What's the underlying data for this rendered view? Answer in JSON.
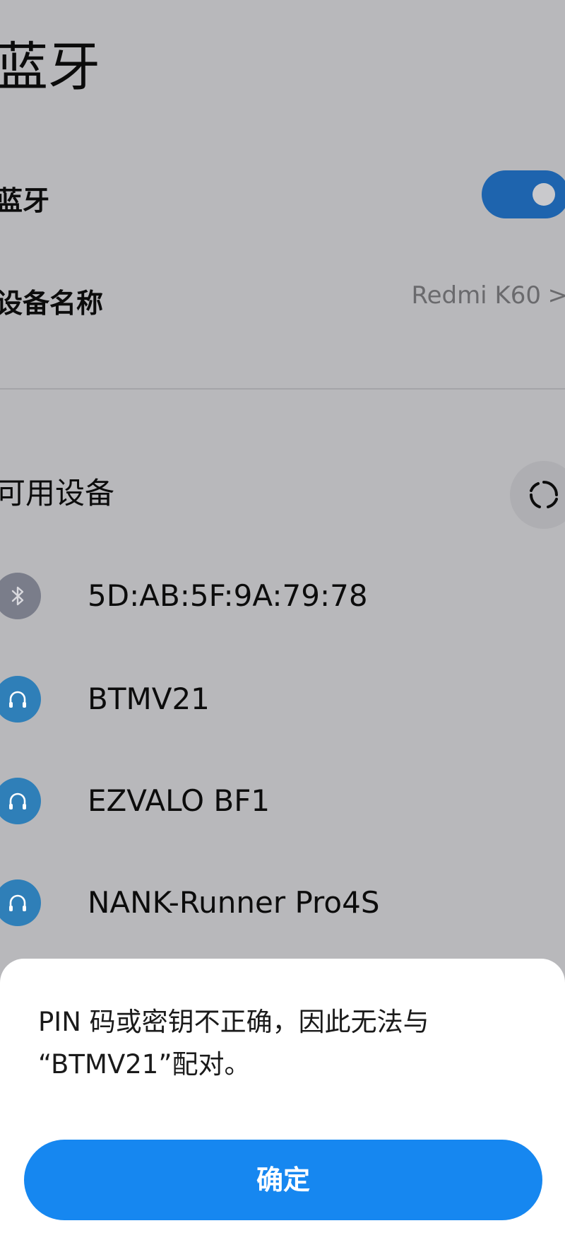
{
  "header": {
    "title": "蓝牙"
  },
  "bluetooth_toggle": {
    "label": "蓝牙",
    "enabled": true
  },
  "device_name": {
    "label": "设备名称",
    "value": "Redmi K60",
    "chevron": ">"
  },
  "available": {
    "label": "可用设备",
    "refresh_icon": "refresh-icon",
    "devices": [
      {
        "name": "5D:AB:5F:9A:79:78",
        "icon": "bluetooth-icon",
        "icon_color": "#7a7d8a"
      },
      {
        "name": "BTMV21",
        "icon": "headphones-icon",
        "icon_color": "#2f7fb8"
      },
      {
        "name": "EZVALO BF1",
        "icon": "headphones-icon",
        "icon_color": "#2f7fb8"
      },
      {
        "name": "NANK-Runner Pro4S",
        "icon": "headphones-icon",
        "icon_color": "#2f7fb8"
      }
    ]
  },
  "dialog": {
    "message_line1": "PIN 码或密钥不正确，因此无法与",
    "message_line2": "“BTMV21”配对。",
    "confirm_label": "确定"
  },
  "colors": {
    "accent": "#1687f0",
    "toggle_on": "#1e64ae",
    "overlay_bg": "#b8b8bb"
  }
}
